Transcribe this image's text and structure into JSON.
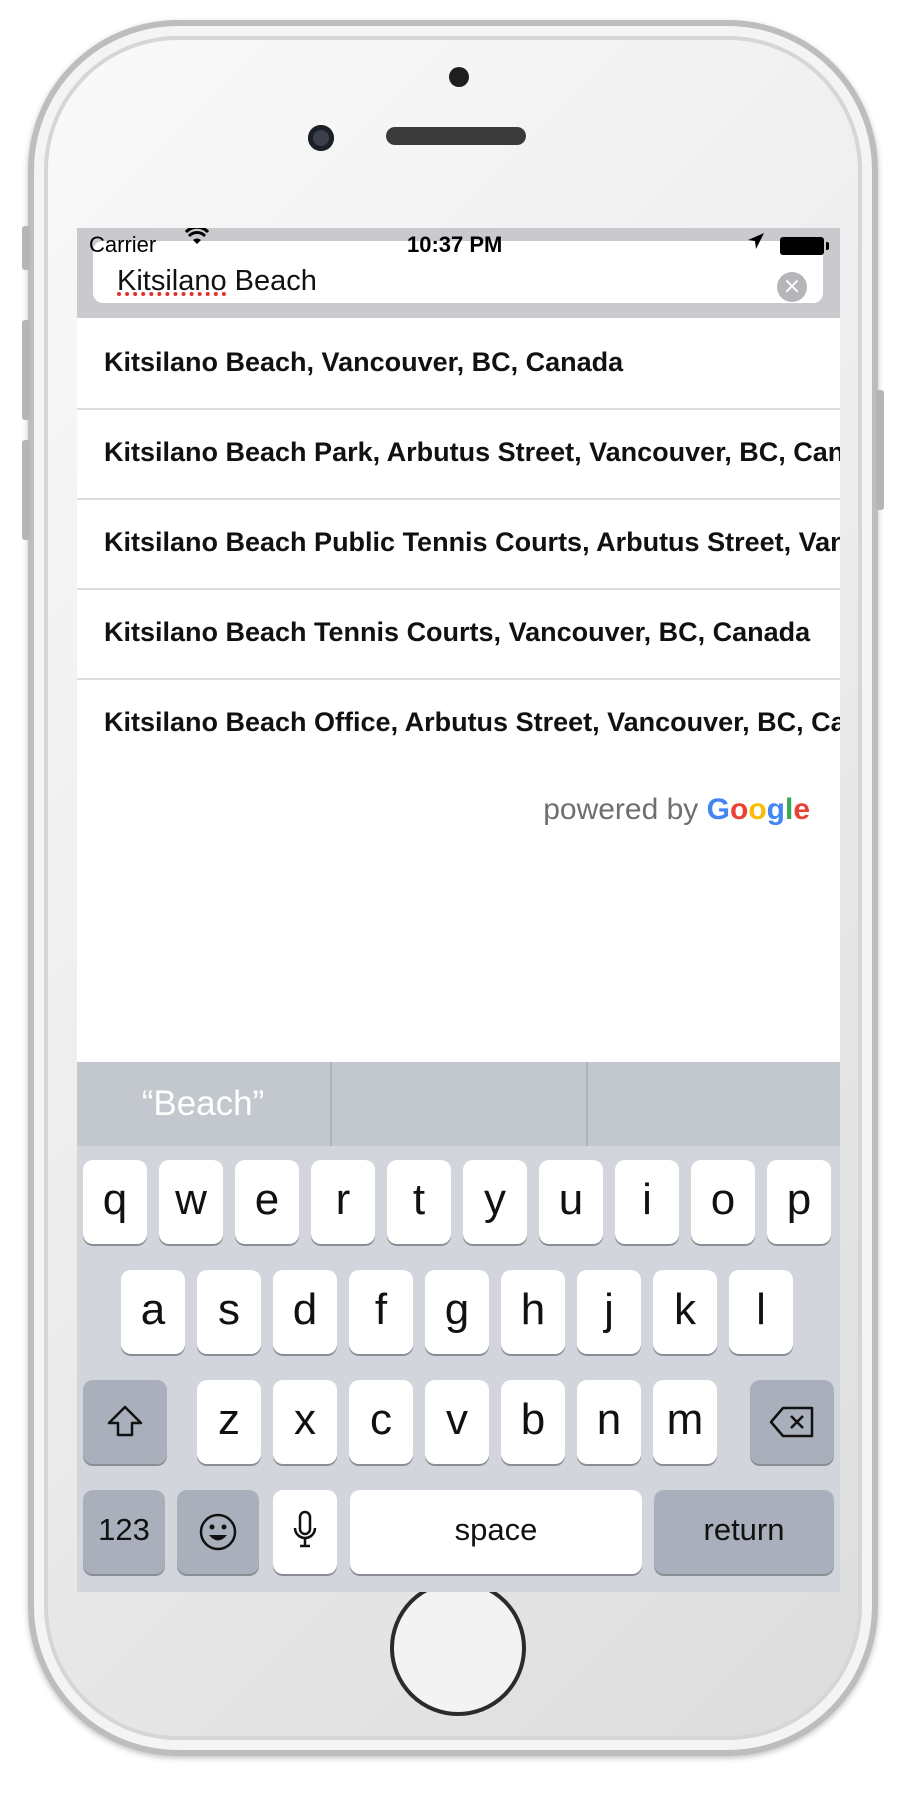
{
  "status": {
    "carrier": "Carrier",
    "time": "10:37 PM"
  },
  "search": {
    "misspelled": "Kitsilano",
    "rest": " Beach",
    "clear": "×"
  },
  "results": [
    "Kitsilano Beach, Vancouver, BC, Canada",
    "Kitsilano Beach Park, Arbutus Street, Vancouver, BC, Canada",
    "Kitsilano Beach Public Tennis Courts, Arbutus Street, Vancouver, BC, Canada",
    "Kitsilano Beach Tennis Courts, Vancouver, BC, Canada",
    "Kitsilano Beach Office, Arbutus Street, Vancouver, BC, Canada"
  ],
  "powered": {
    "text": "powered by ",
    "g1": "G",
    "o1": "o",
    "o2": "o",
    "g2": "g",
    "l": "l",
    "e": "e"
  },
  "keyboard": {
    "prediction": "“Beach”",
    "row1": [
      "q",
      "w",
      "e",
      "r",
      "t",
      "y",
      "u",
      "i",
      "o",
      "p"
    ],
    "row2": [
      "a",
      "s",
      "d",
      "f",
      "g",
      "h",
      "j",
      "k",
      "l"
    ],
    "row3": [
      "z",
      "x",
      "c",
      "v",
      "b",
      "n",
      "m"
    ],
    "numbers": "123",
    "space": "space",
    "return": "return"
  },
  "colors": {
    "google_blue": "#4285F4",
    "google_red": "#EA4335",
    "google_yellow": "#FBBC05",
    "google_green": "#34A853"
  }
}
